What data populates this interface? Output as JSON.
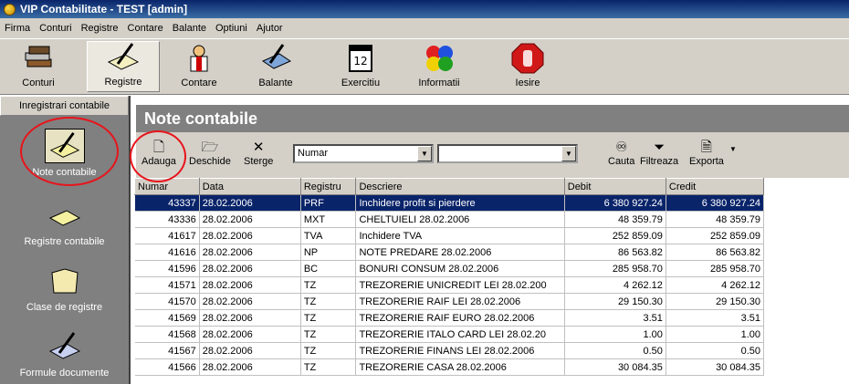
{
  "window": {
    "title": "VIP Contabilitate - TEST [admin]"
  },
  "menu": [
    "Firma",
    "Conturi",
    "Registre",
    "Contare",
    "Balante",
    "Optiuni",
    "Ajutor"
  ],
  "toolbar": [
    {
      "label": "Conturi",
      "icon": "books-icon"
    },
    {
      "label": "Registre",
      "icon": "register-pen-icon"
    },
    {
      "label": "Contare",
      "icon": "doctor-icon"
    },
    {
      "label": "Balante",
      "icon": "scales-icon"
    },
    {
      "label": "Exercitiu",
      "icon": "calendar-icon"
    },
    {
      "label": "Informatii",
      "icon": "info-circles-icon"
    },
    {
      "label": "Iesire",
      "icon": "stop-hand-icon"
    }
  ],
  "sidebar": {
    "header": "Inregistrari contabile",
    "items": [
      {
        "label": "Note contabile",
        "icon": "notes-pen-icon"
      },
      {
        "label": "Registre contabile",
        "icon": "ledger-icon"
      },
      {
        "label": "Clase de registre",
        "icon": "folder-icon"
      },
      {
        "label": "Formule documente",
        "icon": "formula-pen-icon"
      }
    ]
  },
  "main": {
    "title": "Note contabile",
    "actions": [
      "Adauga",
      "Deschide",
      "Sterge"
    ],
    "sort_combo": "Numar",
    "filter_combo": "",
    "tools": [
      "Cauta",
      "Filtreaza",
      "Exporta"
    ]
  },
  "table": {
    "columns": [
      "Numar",
      "Data",
      "Registru",
      "Descriere",
      "Debit",
      "Credit"
    ],
    "rows": [
      [
        "43337",
        "28.02.2006",
        "PRF",
        "Inchidere profit si pierdere",
        "6 380 927.24",
        "6 380 927.24"
      ],
      [
        "43336",
        "28.02.2006",
        "MXT",
        "CHELTUIELI 28.02.2006",
        "48 359.79",
        "48 359.79"
      ],
      [
        "41617",
        "28.02.2006",
        "TVA",
        "Inchidere TVA",
        "252 859.09",
        "252 859.09"
      ],
      [
        "41616",
        "28.02.2006",
        "NP",
        "NOTE PREDARE 28.02.2006",
        "86 563.82",
        "86 563.82"
      ],
      [
        "41596",
        "28.02.2006",
        "BC",
        "BONURI CONSUM 28.02.2006",
        "285 958.70",
        "285 958.70"
      ],
      [
        "41571",
        "28.02.2006",
        "TZ",
        "TREZORERIE UNICREDIT LEI 28.02.200",
        "4 262.12",
        "4 262.12"
      ],
      [
        "41570",
        "28.02.2006",
        "TZ",
        "TREZORERIE RAIF LEI 28.02.2006",
        "29 150.30",
        "29 150.30"
      ],
      [
        "41569",
        "28.02.2006",
        "TZ",
        "TREZORERIE RAIF EURO 28.02.2006",
        "3.51",
        "3.51"
      ],
      [
        "41568",
        "28.02.2006",
        "TZ",
        "TREZORERIE ITALO CARD LEI 28.02.20",
        "1.00",
        "1.00"
      ],
      [
        "41567",
        "28.02.2006",
        "TZ",
        "TREZORERIE FINANS LEI 28.02.2006",
        "0.50",
        "0.50"
      ],
      [
        "41566",
        "28.02.2006",
        "TZ",
        "TREZORERIE CASA 28.02.2006",
        "30 084.35",
        "30 084.35"
      ]
    ]
  },
  "colors": {
    "selection": "#0a246a",
    "annotation": "#e8141b",
    "panel": "#808080"
  }
}
